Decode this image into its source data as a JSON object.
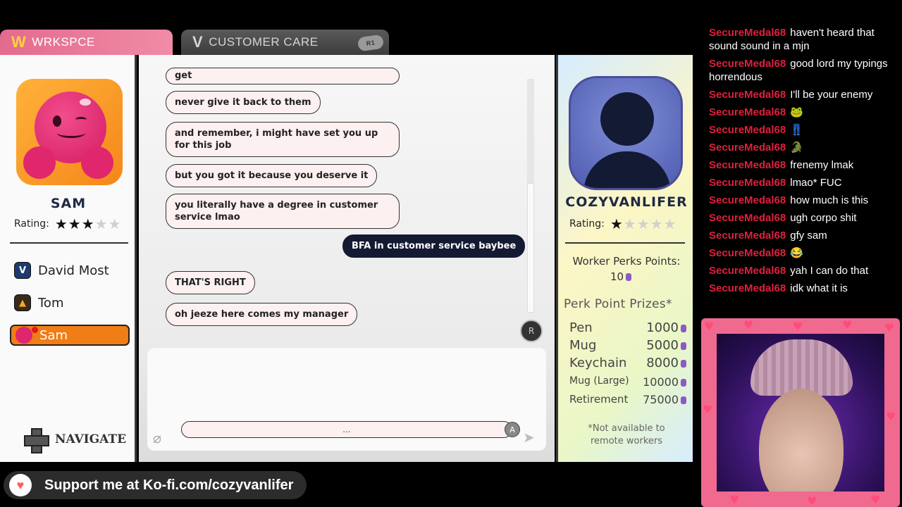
{
  "tabs": {
    "workspace": {
      "label": "WRKSPCE",
      "logo": "W"
    },
    "customer_care": {
      "label": "CUSTOMER CARE",
      "logo": "V",
      "shortcut": "R1"
    }
  },
  "left_panel": {
    "profile_name": "SAM",
    "rating_label": "Rating:",
    "rating": {
      "filled": 3,
      "total": 5
    },
    "contacts": [
      {
        "name": "David Most",
        "icon": "v-logo-icon",
        "active": false
      },
      {
        "name": "Tom",
        "icon": "warning-triangle-icon",
        "active": false
      },
      {
        "name": "Sam",
        "icon": "pink-blob-icon",
        "active": true
      }
    ],
    "navigate_label": "NAVIGATE"
  },
  "chat": {
    "messages": [
      {
        "text": "get",
        "from": "them"
      },
      {
        "text": "never give it back to them",
        "from": "them"
      },
      {
        "text": "and remember, i might have set you up for this job",
        "from": "them"
      },
      {
        "text": "but you got it because you deserve it",
        "from": "them"
      },
      {
        "text": "you literally have a degree in customer service lmao",
        "from": "them"
      },
      {
        "text": "BFA in customer service baybee",
        "from": "me"
      },
      {
        "text": "THAT'S RIGHT",
        "from": "them"
      },
      {
        "text": "oh jeeze here comes my manager",
        "from": "them"
      }
    ],
    "scroll_button": "R",
    "input_text": "...",
    "input_button": "A"
  },
  "profile": {
    "name": "COZYVANLIFER",
    "rating_label": "Rating:",
    "rating": {
      "filled": 1,
      "total": 5
    },
    "perks_label": "Worker Perks Points:",
    "perks_value": "10",
    "prizes_title": "Perk Point Prizes*",
    "prizes": [
      {
        "name": "Pen",
        "cost": "1000"
      },
      {
        "name": "Mug",
        "cost": "5000"
      },
      {
        "name": "Keychain",
        "cost": "8000"
      },
      {
        "name": "Mug (Large)",
        "cost": "10000"
      },
      {
        "name": "Retirement",
        "cost": "75000"
      }
    ],
    "footnote": "*Not available to remote workers"
  },
  "stream_chat": [
    {
      "user": "SecureMedal68",
      "text": "haven't heard that sound sound in a mjn"
    },
    {
      "user": "SecureMedal68",
      "text": "good lord my typings horrendous"
    },
    {
      "user": "SecureMedal68",
      "text": "I'll be your enemy"
    },
    {
      "user": "SecureMedal68",
      "text": "🐸"
    },
    {
      "user": "SecureMedal68",
      "text": "👖"
    },
    {
      "user": "SecureMedal68",
      "text": "🐊"
    },
    {
      "user": "SecureMedal68",
      "text": "frenemy lmak"
    },
    {
      "user": "SecureMedal68",
      "text": "lmao* FUC"
    },
    {
      "user": "SecureMedal68",
      "text": "how much is this"
    },
    {
      "user": "SecureMedal68",
      "text": "ugh corpo shit"
    },
    {
      "user": "SecureMedal68",
      "text": "gfy sam"
    },
    {
      "user": "SecureMedal68",
      "text": "😂"
    },
    {
      "user": "SecureMedal68",
      "text": "yah I can do that"
    },
    {
      "user": "SecureMedal68",
      "text": "idk what it is"
    }
  ],
  "kofi": {
    "text": "Support me at Ko-fi.com/cozyvanlifer"
  },
  "colors": {
    "tab_active": "#e36b8d",
    "contact_active": "#f07d16",
    "my_bubble": "#151a33",
    "their_bubble": "#fdf0f0",
    "chat_username": "#e0203c"
  }
}
